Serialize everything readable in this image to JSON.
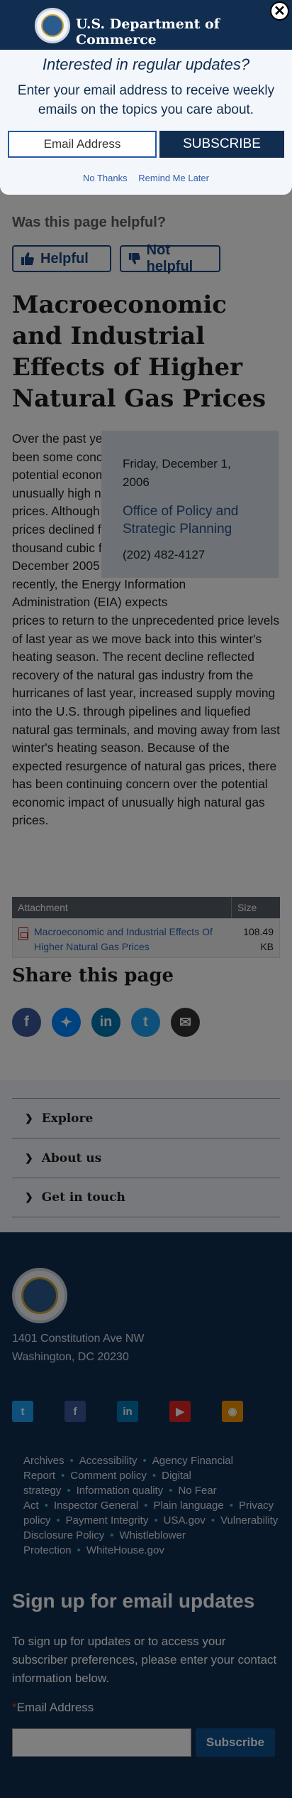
{
  "modal": {
    "agency": "U.S. Department of Commerce",
    "close_glyph": "✕",
    "question": "Interested in regular updates?",
    "description": "Enter your email address to receive weekly emails on the topics you care about.",
    "email_placeholder": "Email Address",
    "subscribe_label": "SUBSCRIBE",
    "no_thanks": "No Thanks",
    "remind_later": "Remind Me Later"
  },
  "feedback": {
    "question": "Was this page helpful?",
    "helpful": "Helpful",
    "not_helpful": "Not helpful"
  },
  "article": {
    "title": "Macroeconomic and Industrial Effects of Higher Natural Gas Prices",
    "date": "Friday, December 1, 2006",
    "office": "Office of Policy and Strategic Planning",
    "phone": "(202) 482-4127",
    "body": "Over the past year, there has been some concern over the potential economic impact of unusually high natural gas prices. Although natural gas prices declined from $10 per thousand cubic feet (mcf) in December 2005 to about $6 recently, the Energy Information Administration (EIA) expects prices to return to the unprecedented price levels of last year as we move back into this winter's heating season. The recent decline reflected recovery of the natural gas industry from the hurricanes of last year, increased supply moving into the U.S. through pipelines and liquefied natural gas terminals, and moving away from last winter's heating season. Because of the expected resurgence of natural gas prices, there has been continuing concern over the potential economic impact of unusually high natural gas prices."
  },
  "attachments": {
    "col_attachment": "Attachment",
    "col_size": "Size",
    "rows": [
      {
        "name": "Macroeconomic and Industrial Effects Of Higher Natural Gas Prices",
        "size": "108.49 KB"
      }
    ]
  },
  "share": {
    "title": "Share this page",
    "icons": [
      {
        "name": "facebook-icon",
        "glyph": "f",
        "color": "#3b5998"
      },
      {
        "name": "messenger-icon",
        "glyph": "✦",
        "color": "#0084ff"
      },
      {
        "name": "linkedin-icon",
        "glyph": "in",
        "color": "#0077b5"
      },
      {
        "name": "twitter-icon",
        "glyph": "t",
        "color": "#1da1f2"
      },
      {
        "name": "email-icon",
        "glyph": "✉",
        "color": "#333333"
      }
    ]
  },
  "footer_nav": {
    "items": [
      "Explore",
      "About us",
      "Get in touch"
    ]
  },
  "footer": {
    "address_line1": "1401 Constitution Ave NW",
    "address_line2": "Washington, DC 20230",
    "social": [
      {
        "name": "twitter-icon",
        "glyph": "t",
        "color": "#1da1f2"
      },
      {
        "name": "facebook-icon",
        "glyph": "f",
        "color": "#3b5998"
      },
      {
        "name": "linkedin-icon",
        "glyph": "in",
        "color": "#0077b5"
      },
      {
        "name": "youtube-icon",
        "glyph": "▶",
        "color": "#e02424"
      },
      {
        "name": "rss-icon",
        "glyph": "◉",
        "color": "#f29200"
      }
    ],
    "links": [
      "Archives",
      "Accessibility",
      "Agency Financial Report",
      "Comment policy",
      "Digital strategy",
      "Information quality",
      "No Fear Act",
      "Inspector General",
      "Plain language",
      "Privacy policy",
      "Payment Integrity",
      "USA.gov",
      "Vulnerability Disclosure Policy",
      "Whistleblower Protection",
      "WhiteHouse.gov"
    ],
    "signup_title": "Sign up for email updates",
    "signup_text": "To sign up for updates or to access your subscriber preferences, please enter your contact information below.",
    "email_label": "Email Address",
    "required_mark": "*",
    "subscribe_label": "Subscribe"
  }
}
